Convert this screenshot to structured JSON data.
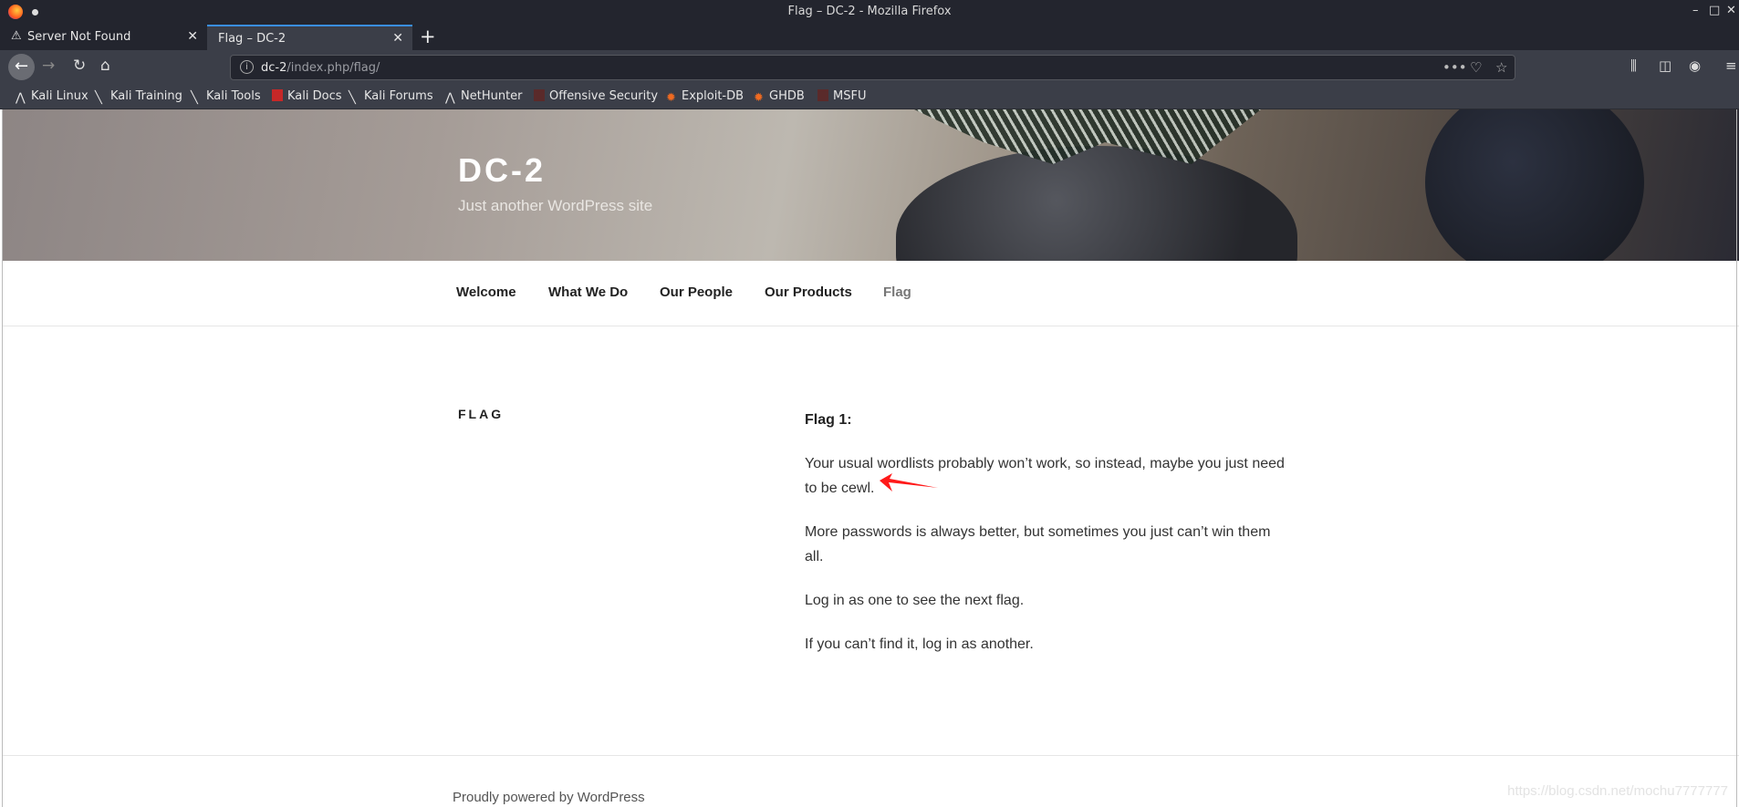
{
  "window": {
    "title": "Flag – DC-2 - Mozilla Firefox",
    "controls": {
      "minimize": "–",
      "maximize": "□",
      "close": "✕"
    }
  },
  "tabs": [
    {
      "label": "Server Not Found",
      "icon": "warning-icon",
      "active": false
    },
    {
      "label": "Flag – DC-2",
      "active": true
    }
  ],
  "new_tab": "+",
  "address": {
    "host": "dc-2",
    "path": "/index.php/flag/"
  },
  "bookmarks": [
    {
      "label": "Kali Linux",
      "icon": "kali-icon"
    },
    {
      "label": "Kali Training",
      "icon": "kali-dragon-icon"
    },
    {
      "label": "Kali Tools",
      "icon": "kali-dragon-icon"
    },
    {
      "label": "Kali Docs",
      "icon": "docs-icon"
    },
    {
      "label": "Kali Forums",
      "icon": "kali-dragon-icon"
    },
    {
      "label": "NetHunter",
      "icon": "nethunter-icon"
    },
    {
      "label": "Offensive Security",
      "icon": "offsec-icon"
    },
    {
      "label": "Exploit-DB",
      "icon": "exploitdb-icon"
    },
    {
      "label": "GHDB",
      "icon": "exploitdb-icon"
    },
    {
      "label": "MSFU",
      "icon": "offsec-icon"
    }
  ],
  "site": {
    "title": "DC-2",
    "tagline": "Just another WordPress site"
  },
  "menu": [
    {
      "label": "Welcome"
    },
    {
      "label": "What We Do"
    },
    {
      "label": "Our People"
    },
    {
      "label": "Our Products"
    },
    {
      "label": "Flag",
      "current": true
    }
  ],
  "page": {
    "title": "FLAG",
    "heading": "Flag 1:",
    "paragraphs": [
      "Your usual wordlists probably won’t work, so instead, maybe you just need to be cewl.",
      "More passwords is always better, but sometimes you just can’t win them all.",
      "Log in as one to see the next flag.",
      "If you can’t find it, log in as another."
    ]
  },
  "footer": {
    "text": "Proudly powered by WordPress"
  },
  "watermark": "https://blog.csdn.net/mochu7777777",
  "colors": {
    "accent": "#3a8ee6",
    "annotation_arrow": "#ff1a1a"
  }
}
